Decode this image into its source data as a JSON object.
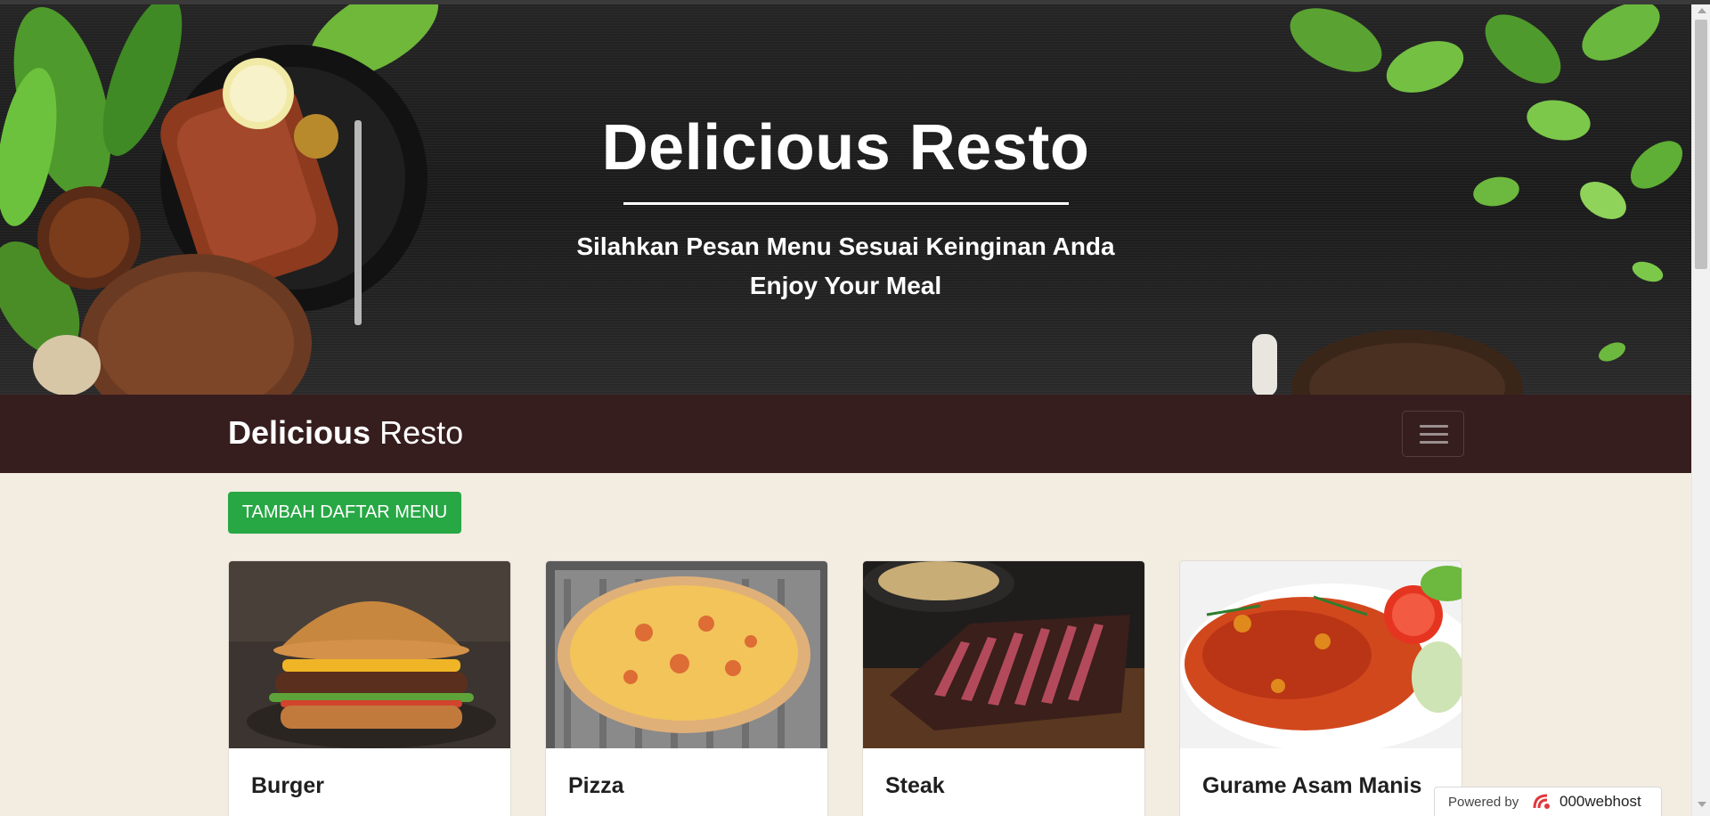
{
  "hero": {
    "title": "Delicious Resto",
    "subtitle_line1": "Silahkan Pesan Menu Sesuai Keinginan Anda",
    "subtitle_line2": "Enjoy Your Meal"
  },
  "navbar": {
    "brand_bold": "Delicious",
    "brand_light": " Resto",
    "toggler_icon": "hamburger-icon"
  },
  "actions": {
    "add_menu_label": "TAMBAH DAFTAR MENU"
  },
  "menu": {
    "items": [
      {
        "name": "Burger",
        "image": "burger-photo"
      },
      {
        "name": "Pizza",
        "image": "pizza-photo"
      },
      {
        "name": "Steak",
        "image": "steak-photo"
      },
      {
        "name": "Gurame Asam Manis",
        "image": "gurame-photo"
      }
    ]
  },
  "footer_badge": {
    "label": "Powered by",
    "brand": "000webhost"
  },
  "colors": {
    "navbar_bg": "#361d1e",
    "page_bg": "#f3ece0",
    "button_green": "#28a745",
    "hero_bg": "#1e1e1e"
  }
}
